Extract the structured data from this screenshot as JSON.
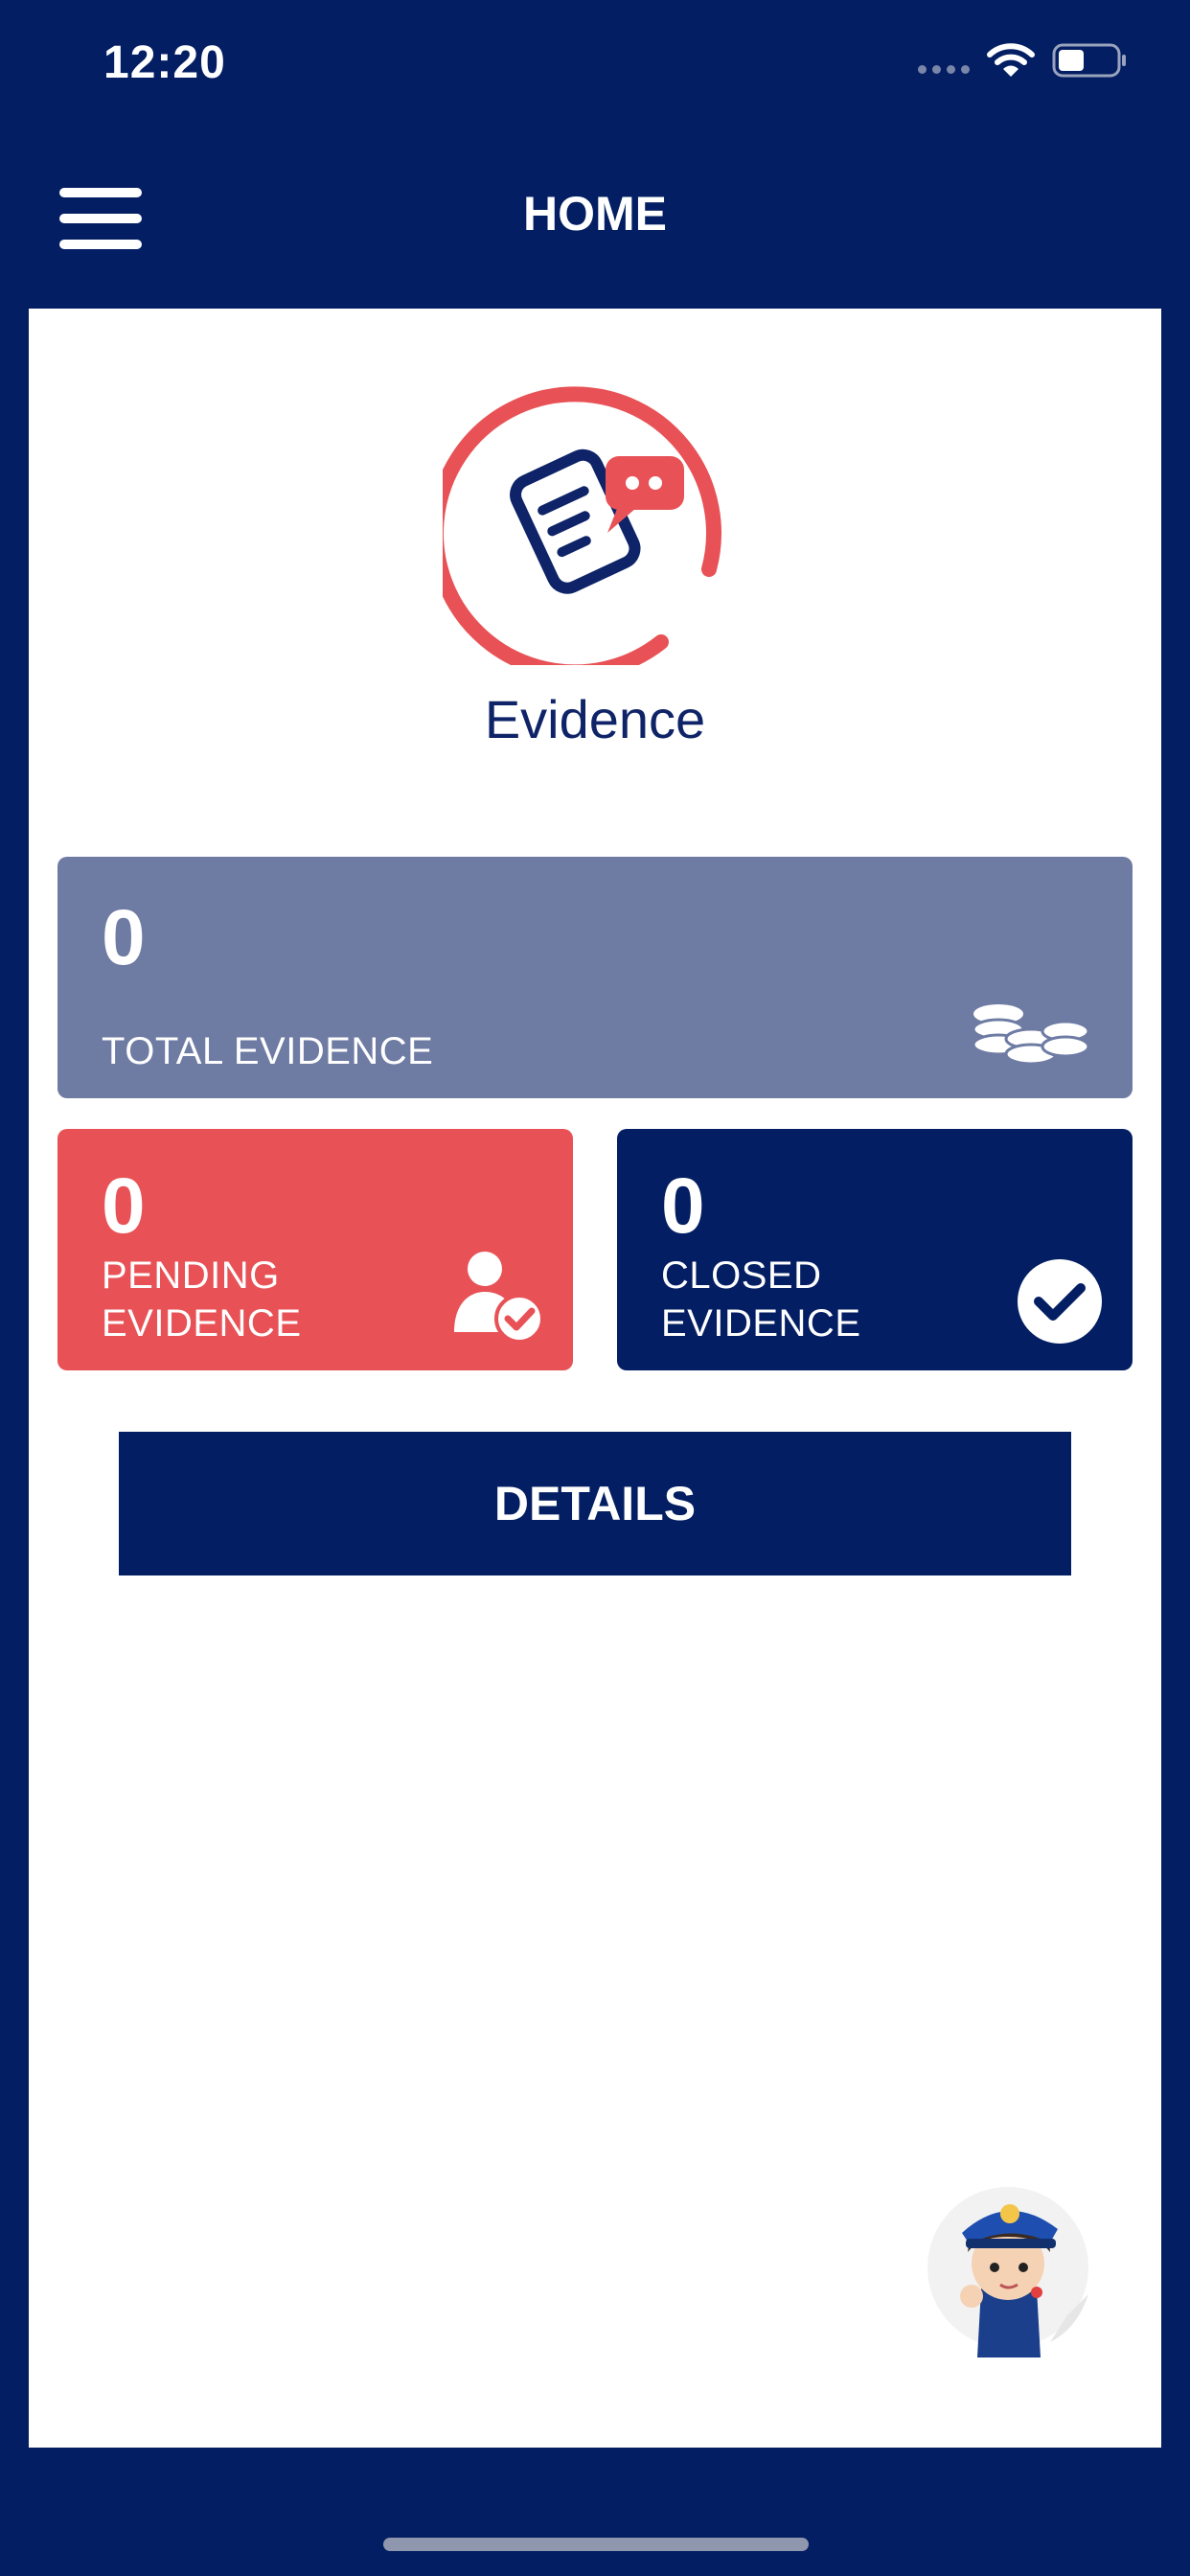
{
  "status_bar": {
    "time": "12:20",
    "icons": [
      "signal-icon",
      "wifi-icon",
      "battery-icon"
    ]
  },
  "header": {
    "menu_icon": "hamburger-menu-icon",
    "title": "HOME"
  },
  "module": {
    "icon": "evidence-icon",
    "title": "Evidence"
  },
  "stats": {
    "total": {
      "value": "0",
      "label": "TOTAL EVIDENCE",
      "icon": "coins-icon",
      "color": "#6e7ba3"
    },
    "pending": {
      "value": "0",
      "label_line1": "PENDING",
      "label_line2": "EVIDENCE",
      "icon": "user-check-icon",
      "color": "#e85256"
    },
    "closed": {
      "value": "0",
      "label_line1": "CLOSED",
      "label_line2": "EVIDENCE",
      "icon": "check-circle-icon",
      "color": "#031e62"
    }
  },
  "actions": {
    "details_label": "DETAILS"
  },
  "assistant": {
    "icon": "police-mascot-icon"
  },
  "colors": {
    "primary": "#031e62",
    "accent": "#e85256",
    "surface": "#ffffff"
  }
}
